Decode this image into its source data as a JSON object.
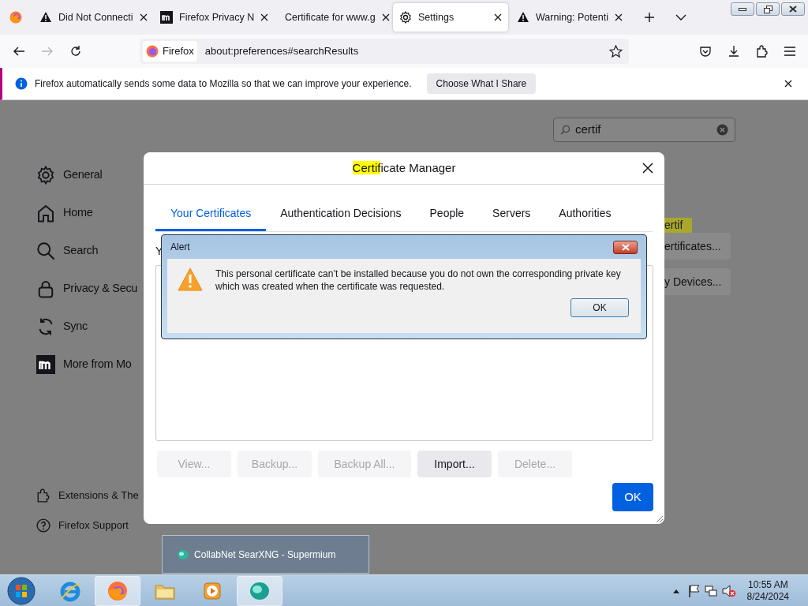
{
  "tabs": [
    {
      "label": "Did Not Connecti",
      "kind": "warning",
      "selected": false
    },
    {
      "label": "Firefox Privacy N",
      "kind": "mozilla",
      "selected": false
    },
    {
      "label": "Certificate for www.g",
      "kind": "plain",
      "selected": false
    },
    {
      "label": "Settings",
      "kind": "gear",
      "selected": true
    },
    {
      "label": "Warning: Potenti",
      "kind": "warning",
      "selected": false
    }
  ],
  "nav": {
    "identity": "Firefox",
    "url": "about:preferences#searchResults"
  },
  "notification": {
    "message": "Firefox automatically sends some data to Mozilla so that we can improve your experience.",
    "button": "Choose What I Share"
  },
  "sidebar": {
    "items": [
      {
        "label": "General",
        "kind": "gear"
      },
      {
        "label": "Home",
        "kind": "home"
      },
      {
        "label": "Search",
        "kind": "search"
      },
      {
        "label": "Privacy & Secu",
        "kind": "lock"
      },
      {
        "label": "Sync",
        "kind": "sync"
      },
      {
        "label": "More from Mo",
        "kind": "mozilla"
      }
    ],
    "footer": [
      {
        "label": "Extensions & The",
        "kind": "puzzle"
      },
      {
        "label": "Firefox Support",
        "kind": "help"
      }
    ]
  },
  "search": {
    "value": "certif"
  },
  "results": {
    "highlight": "ertif",
    "buttons": [
      "ertificates...",
      "y Devices..."
    ]
  },
  "dialog": {
    "title": [
      {
        "text": "Certif",
        "highlighted": true
      },
      {
        "text": "icate Manager",
        "highlighted": false
      }
    ],
    "tabs": [
      {
        "label": "Your Certificates",
        "selected": true
      },
      {
        "label": "Authentication Decisions",
        "selected": false
      },
      {
        "label": "People",
        "selected": false
      },
      {
        "label": "Servers",
        "selected": false
      },
      {
        "label": "Authorities",
        "selected": false
      }
    ],
    "intro": "Y",
    "buttons": [
      {
        "label": "View...",
        "disabled": true
      },
      {
        "label": "Backup...",
        "disabled": true
      },
      {
        "label": "Backup All...",
        "disabled": true
      },
      {
        "label": "Import...",
        "disabled": false
      },
      {
        "label": "Delete...",
        "disabled": true
      }
    ],
    "ok": "OK"
  },
  "alert": {
    "title": "Alert",
    "message_lines": [
      "This personal certificate can’t be installed because you do not own the corresponding private key",
      "which was created when the certificate was requested."
    ],
    "ok": "OK"
  },
  "taskbar_preview": {
    "title": "CollabNet SearXNG - Supermium"
  },
  "taskbar": {
    "apps": [
      {
        "kind": "ie",
        "active": false
      },
      {
        "kind": "firefox",
        "active": true
      },
      {
        "kind": "explorer",
        "active": false
      },
      {
        "kind": "media",
        "active": false
      },
      {
        "kind": "supermium",
        "active": true
      }
    ],
    "time": "10:55 AM",
    "date": "8/24/2024"
  }
}
